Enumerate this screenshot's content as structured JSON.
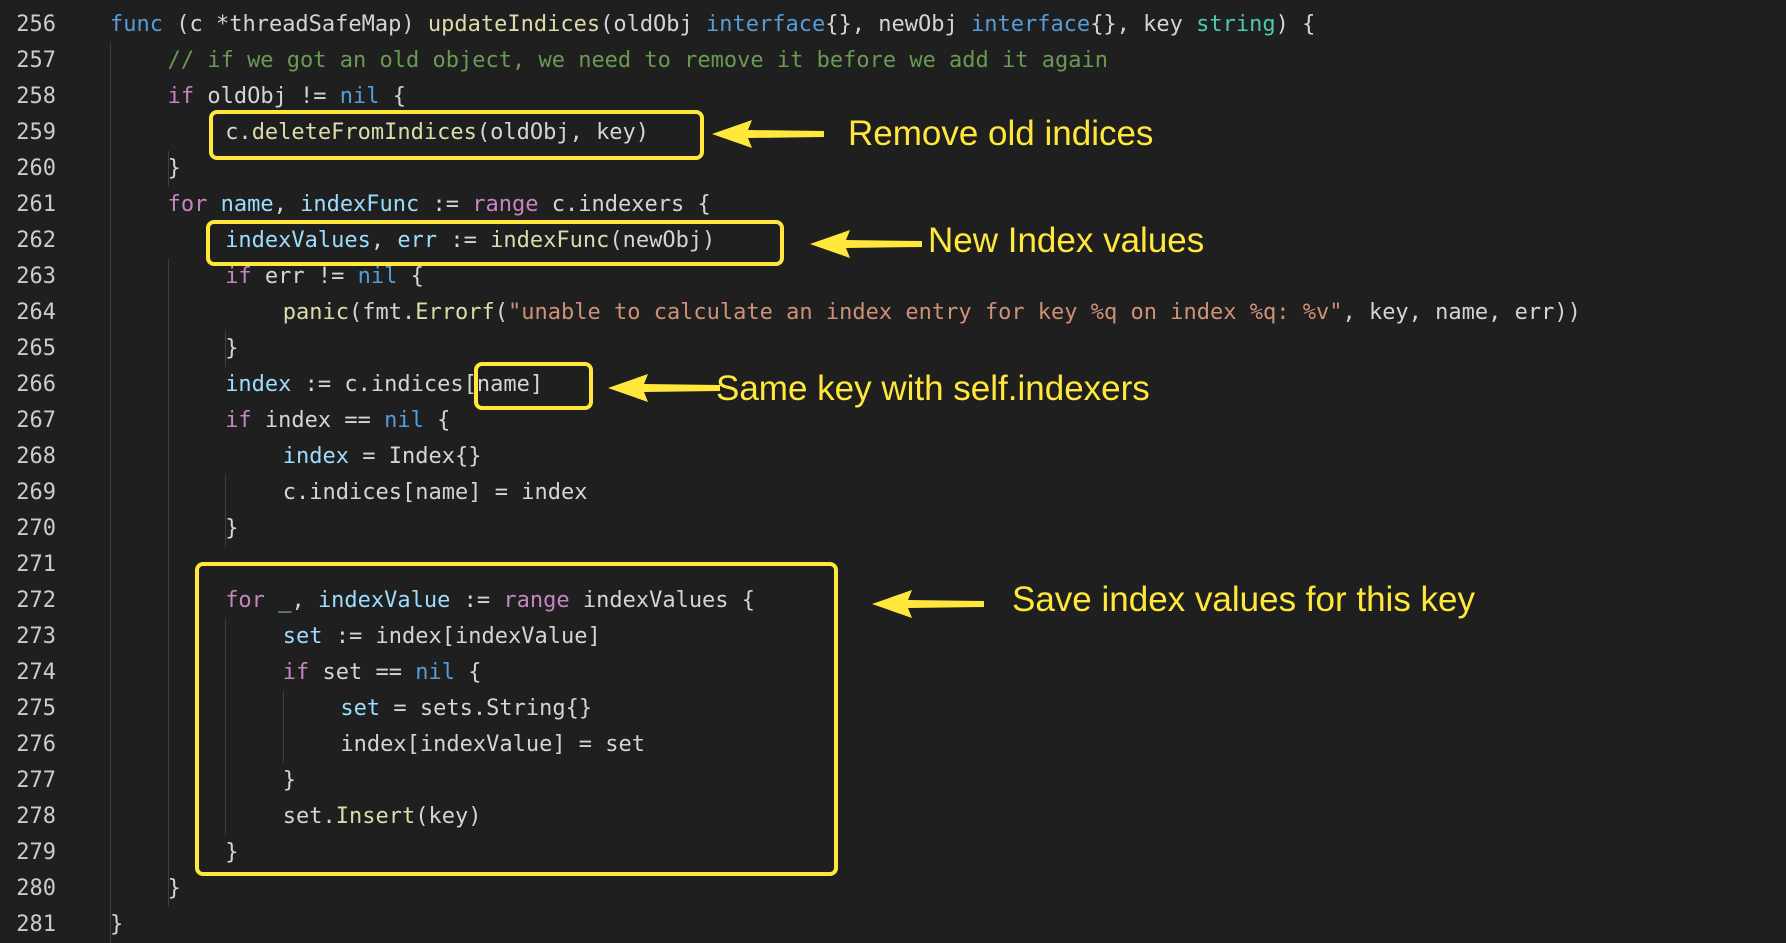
{
  "editor": {
    "language": "go",
    "colors": {
      "background": "#1f1f1f",
      "annotation": "#ffe83b",
      "keyword": "#c586c0",
      "keyword_blue": "#569cd6",
      "variable": "#9cdcfe",
      "function": "#dcdcaa",
      "string": "#ce9178",
      "type": "#4ec9b0",
      "comment": "#6a9955",
      "plain": "#d4d4d4"
    },
    "lines": [
      {
        "num": "256",
        "indent": 0,
        "tokens": [
          [
            "kwb",
            "func"
          ],
          [
            "pl",
            " (c *threadSafeMap) "
          ],
          [
            "fn",
            "updateIndices"
          ],
          [
            "pl",
            "(oldObj "
          ],
          [
            "kwb",
            "interface"
          ],
          [
            "pl",
            "{}, newObj "
          ],
          [
            "kwb",
            "interface"
          ],
          [
            "pl",
            "{}, key "
          ],
          [
            "ty",
            "string"
          ],
          [
            "pl",
            ") {"
          ]
        ]
      },
      {
        "num": "257",
        "indent": 1,
        "tokens": [
          [
            "cmt",
            "// if we got an old object, we need to remove it before we add it again"
          ]
        ]
      },
      {
        "num": "258",
        "indent": 1,
        "tokens": [
          [
            "kw",
            "if"
          ],
          [
            "pl",
            " oldObj != "
          ],
          [
            "kwb",
            "nil"
          ],
          [
            "pl",
            " {"
          ]
        ]
      },
      {
        "num": "259",
        "indent": 2,
        "tokens": [
          [
            "pl",
            "c."
          ],
          [
            "fn",
            "deleteFromIndices"
          ],
          [
            "pl",
            "(oldObj, key)"
          ]
        ]
      },
      {
        "num": "260",
        "indent": 1,
        "tokens": [
          [
            "pl",
            "}"
          ]
        ]
      },
      {
        "num": "261",
        "indent": 1,
        "tokens": [
          [
            "kw",
            "for"
          ],
          [
            "pl",
            " "
          ],
          [
            "var",
            "name"
          ],
          [
            "pl",
            ", "
          ],
          [
            "var",
            "indexFunc"
          ],
          [
            "pl",
            " := "
          ],
          [
            "kw",
            "range"
          ],
          [
            "pl",
            " c.indexers {"
          ]
        ]
      },
      {
        "num": "262",
        "indent": 2,
        "tokens": [
          [
            "var",
            "indexValues"
          ],
          [
            "pl",
            ", "
          ],
          [
            "var",
            "err"
          ],
          [
            "pl",
            " := "
          ],
          [
            "fn",
            "indexFunc"
          ],
          [
            "pl",
            "(newObj)"
          ]
        ]
      },
      {
        "num": "263",
        "indent": 2,
        "tokens": [
          [
            "kw",
            "if"
          ],
          [
            "pl",
            " err != "
          ],
          [
            "kwb",
            "nil"
          ],
          [
            "pl",
            " {"
          ]
        ]
      },
      {
        "num": "264",
        "indent": 3,
        "tokens": [
          [
            "fn",
            "panic"
          ],
          [
            "pl",
            "(fmt."
          ],
          [
            "fn",
            "Errorf"
          ],
          [
            "pl",
            "("
          ],
          [
            "str",
            "\"unable to calculate an index entry for key %q on index %q: %v\""
          ],
          [
            "pl",
            ", key, name, err))"
          ]
        ]
      },
      {
        "num": "265",
        "indent": 2,
        "tokens": [
          [
            "pl",
            "}"
          ]
        ]
      },
      {
        "num": "266",
        "indent": 2,
        "tokens": [
          [
            "var",
            "index"
          ],
          [
            "pl",
            " := c.indices[name]"
          ]
        ]
      },
      {
        "num": "267",
        "indent": 2,
        "tokens": [
          [
            "kw",
            "if"
          ],
          [
            "pl",
            " index == "
          ],
          [
            "kwb",
            "nil"
          ],
          [
            "pl",
            " {"
          ]
        ]
      },
      {
        "num": "268",
        "indent": 3,
        "tokens": [
          [
            "var",
            "index"
          ],
          [
            "pl",
            " = Index{}"
          ]
        ]
      },
      {
        "num": "269",
        "indent": 3,
        "tokens": [
          [
            "pl",
            "c.indices[name] = index"
          ]
        ]
      },
      {
        "num": "270",
        "indent": 2,
        "tokens": [
          [
            "pl",
            "}"
          ]
        ]
      },
      {
        "num": "271",
        "indent": 2,
        "tokens": []
      },
      {
        "num": "272",
        "indent": 2,
        "tokens": [
          [
            "kw",
            "for"
          ],
          [
            "pl",
            " "
          ],
          [
            "var",
            "_"
          ],
          [
            "pl",
            ", "
          ],
          [
            "var",
            "indexValue"
          ],
          [
            "pl",
            " := "
          ],
          [
            "kw",
            "range"
          ],
          [
            "pl",
            " indexValues {"
          ]
        ]
      },
      {
        "num": "273",
        "indent": 3,
        "tokens": [
          [
            "var",
            "set"
          ],
          [
            "pl",
            " := index[indexValue]"
          ]
        ]
      },
      {
        "num": "274",
        "indent": 3,
        "tokens": [
          [
            "kw",
            "if"
          ],
          [
            "pl",
            " set == "
          ],
          [
            "kwb",
            "nil"
          ],
          [
            "pl",
            " {"
          ]
        ]
      },
      {
        "num": "275",
        "indent": 4,
        "tokens": [
          [
            "var",
            "set"
          ],
          [
            "pl",
            " = sets.String{}"
          ]
        ]
      },
      {
        "num": "276",
        "indent": 4,
        "tokens": [
          [
            "pl",
            "index[indexValue] = set"
          ]
        ]
      },
      {
        "num": "277",
        "indent": 3,
        "tokens": [
          [
            "pl",
            "}"
          ]
        ]
      },
      {
        "num": "278",
        "indent": 3,
        "tokens": [
          [
            "pl",
            "set."
          ],
          [
            "fn",
            "Insert"
          ],
          [
            "pl",
            "(key)"
          ]
        ]
      },
      {
        "num": "279",
        "indent": 2,
        "tokens": [
          [
            "pl",
            "}"
          ]
        ]
      },
      {
        "num": "280",
        "indent": 1,
        "tokens": [
          [
            "pl",
            "}"
          ]
        ]
      },
      {
        "num": "281",
        "indent": 0,
        "tokens": [
          [
            "pl",
            "}"
          ]
        ]
      }
    ]
  },
  "annotations": {
    "remove_old": "Remove old indices",
    "new_index": "New Index values",
    "same_key": "Same key with self.indexers",
    "save_values": "Save index values for this key"
  }
}
